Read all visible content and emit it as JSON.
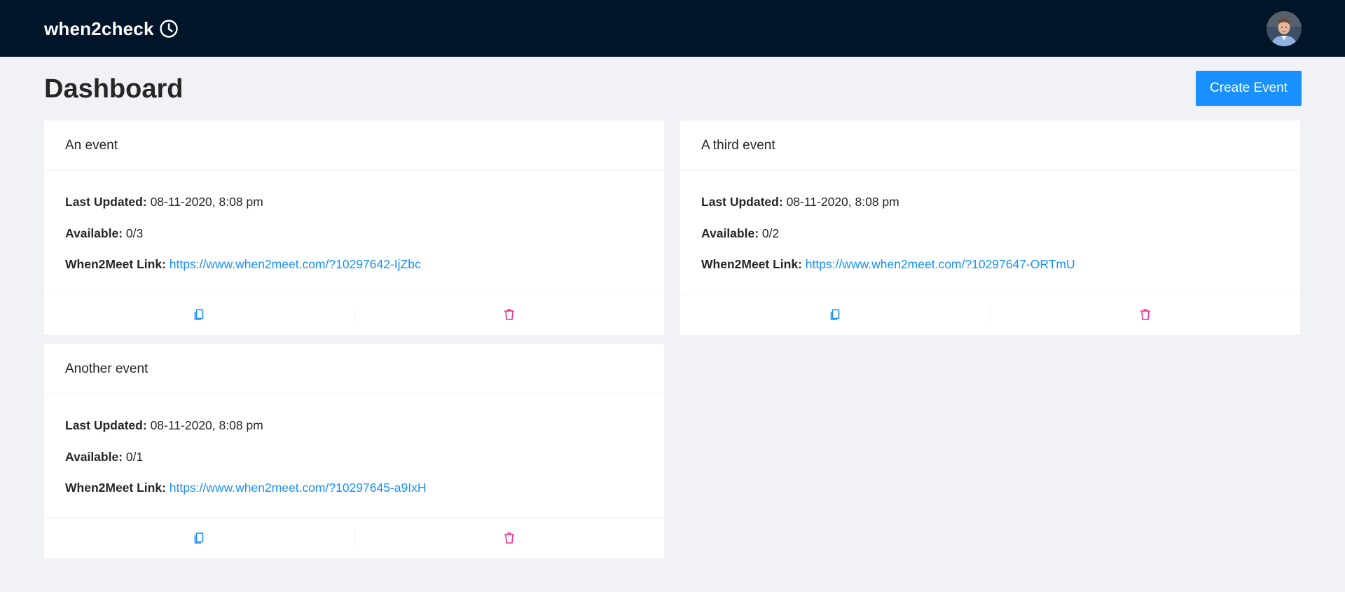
{
  "navbar": {
    "brand": "when2check",
    "brand_icon": "clock-icon",
    "avatar_icon": "user-avatar"
  },
  "page": {
    "title": "Dashboard",
    "create_button": "Create Event"
  },
  "labels": {
    "last_updated": "Last Updated:",
    "available": "Available:",
    "link": "When2Meet Link:"
  },
  "events": [
    {
      "title": "An event",
      "last_updated": "08-11-2020, 8:08 pm",
      "available": "0/3",
      "link": "https://www.when2meet.com/?10297642-IjZbc"
    },
    {
      "title": "A third event",
      "last_updated": "08-11-2020, 8:08 pm",
      "available": "0/2",
      "link": "https://www.when2meet.com/?10297647-ORTmU"
    },
    {
      "title": "Another event",
      "last_updated": "08-11-2020, 8:08 pm",
      "available": "0/1",
      "link": "https://www.when2meet.com/?10297645-a9IxH"
    }
  ],
  "actions": {
    "copy_icon": "copy-icon",
    "delete_icon": "delete-icon"
  },
  "colors": {
    "navbar_bg": "#001529",
    "page_bg": "#f0f2f5",
    "primary": "#1890ff",
    "danger": "#eb2f96"
  }
}
